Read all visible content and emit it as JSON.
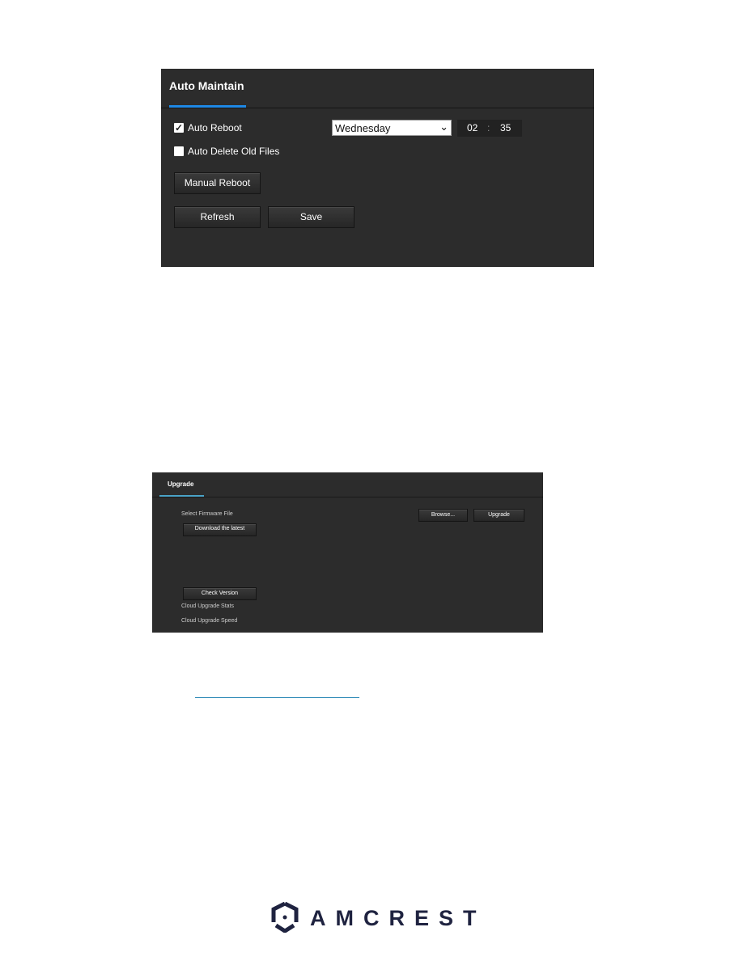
{
  "auto_maintain": {
    "title": "Auto Maintain",
    "auto_reboot": {
      "label": "Auto Reboot",
      "checked": true,
      "day": "Wednesday",
      "hour": "02",
      "separator": ":",
      "minute": "35"
    },
    "auto_delete": {
      "label": "Auto Delete Old Files",
      "checked": false
    },
    "manual_reboot": "Manual Reboot",
    "refresh": "Refresh",
    "save": "Save"
  },
  "upgrade": {
    "title": "Upgrade",
    "select_firmware_label": "Select Firmware File",
    "browse": "Browse...",
    "upgrade_button": "Upgrade",
    "download_latest": "Download the latest",
    "check_version": "Check Version",
    "cloud_upgrade_stats": "Cloud Upgrade Stats",
    "cloud_upgrade_speed": "Cloud Upgrade Speed"
  },
  "footer": {
    "logo_text": "AMCREST"
  },
  "colors": {
    "accent": "#1e88e5",
    "panel": "#2c2c2c",
    "logo": "#1f2340",
    "link": "#1a7fb0"
  }
}
